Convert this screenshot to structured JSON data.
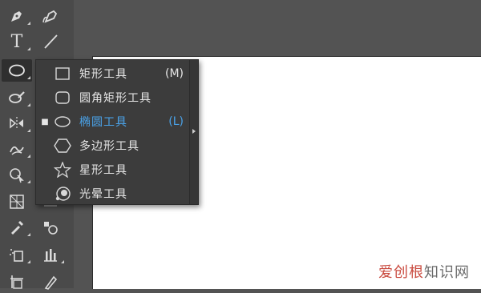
{
  "flyout": {
    "items": [
      {
        "label": "矩形工具",
        "shortcut": "(M)",
        "icon": "rectangle-icon",
        "selected": false
      },
      {
        "label": "圆角矩形工具",
        "shortcut": "",
        "icon": "rounded-rectangle-icon",
        "selected": false
      },
      {
        "label": "椭圆工具",
        "shortcut": "(L)",
        "icon": "ellipse-icon",
        "selected": true
      },
      {
        "label": "多边形工具",
        "shortcut": "",
        "icon": "polygon-icon",
        "selected": false
      },
      {
        "label": "星形工具",
        "shortcut": "",
        "icon": "star-icon",
        "selected": false
      },
      {
        "label": "光晕工具",
        "shortcut": "",
        "icon": "flare-icon",
        "selected": false
      }
    ],
    "selected_marker": "■"
  },
  "toolbar": {
    "type_tool_glyph": "T"
  },
  "colors": {
    "selected_text": "#4aa2e8",
    "menu_bg": "#3c3c3c",
    "toolbar_bg": "#4a4a4a"
  },
  "watermark": {
    "part1": "爱创根",
    "part2": "知识网"
  }
}
